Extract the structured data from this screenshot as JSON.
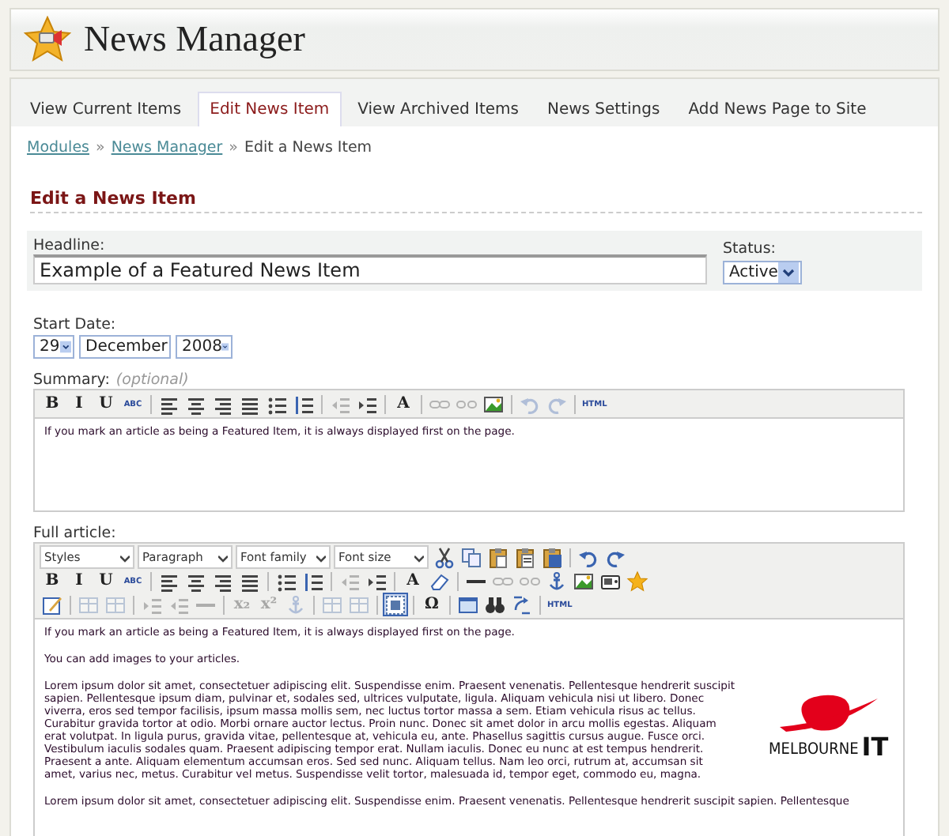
{
  "header": {
    "title": "News Manager"
  },
  "tabs": [
    {
      "label": "View Current Items",
      "selected": false
    },
    {
      "label": "Edit News Item",
      "selected": true
    },
    {
      "label": "View Archived Items",
      "selected": false
    },
    {
      "label": "News Settings",
      "selected": false
    },
    {
      "label": "Add News Page to Site",
      "selected": false
    }
  ],
  "breadcrumb": {
    "links": [
      "Modules",
      "News Manager"
    ],
    "separator": "»",
    "current": "Edit a News Item"
  },
  "section_title": "Edit a News Item",
  "headline": {
    "label": "Headline:",
    "value": "Example of a Featured News Item"
  },
  "status": {
    "label": "Status:",
    "value": "Active"
  },
  "start_date": {
    "label": "Start Date:",
    "day": "29",
    "month": "December",
    "year": "2008"
  },
  "summary": {
    "label": "Summary:",
    "note": "(optional)",
    "toolbar": [
      [
        {
          "kind": "glyph",
          "glyph": "B",
          "disabled": false
        },
        {
          "kind": "glyph",
          "glyph": "I",
          "disabled": false
        },
        {
          "kind": "glyph",
          "glyph": "U",
          "disabled": false
        },
        {
          "kind": "glyph",
          "glyph": "ABC",
          "disabled": false
        }
      ],
      [
        {
          "kind": "align-left",
          "disabled": false
        },
        {
          "kind": "align-center",
          "disabled": false
        },
        {
          "kind": "align-right",
          "disabled": false
        },
        {
          "kind": "justify",
          "disabled": false
        },
        {
          "kind": "bullet-list",
          "disabled": false
        },
        {
          "kind": "numbered-list",
          "disabled": false
        }
      ],
      [
        {
          "kind": "outdent",
          "disabled": true
        },
        {
          "kind": "indent",
          "disabled": false
        }
      ],
      [
        {
          "kind": "glyph",
          "glyph": "A",
          "disabled": false
        }
      ],
      [
        {
          "kind": "link",
          "disabled": true
        },
        {
          "kind": "unlink",
          "disabled": true
        },
        {
          "kind": "image",
          "disabled": false
        }
      ],
      [
        {
          "kind": "undo",
          "disabled": true
        },
        {
          "kind": "redo",
          "disabled": true
        }
      ],
      [
        {
          "kind": "glyph",
          "glyph": "HTML",
          "disabled": false
        }
      ]
    ],
    "paragraphs": [
      "If you mark an article as being a Featured Item, it is always displayed first on the page."
    ]
  },
  "full_article": {
    "label": "Full article:",
    "dropdowns": [
      "Styles",
      "Paragraph",
      "Font family",
      "Font size"
    ],
    "toolbar_rows": [
      [
        [
          {
            "kind": "cut",
            "disabled": false
          },
          {
            "kind": "copy",
            "disabled": false
          },
          {
            "kind": "paste",
            "disabled": false
          },
          {
            "kind": "paste-text",
            "disabled": false
          },
          {
            "kind": "paste-word",
            "disabled": false
          }
        ],
        [
          {
            "kind": "undo",
            "disabled": false
          },
          {
            "kind": "redo",
            "disabled": false
          }
        ]
      ],
      [
        [
          {
            "kind": "glyph",
            "glyph": "B",
            "disabled": false
          },
          {
            "kind": "glyph",
            "glyph": "I",
            "disabled": false
          },
          {
            "kind": "glyph",
            "glyph": "U",
            "disabled": false
          },
          {
            "kind": "glyph",
            "glyph": "ABC",
            "disabled": false
          }
        ],
        [
          {
            "kind": "align-left",
            "disabled": false
          },
          {
            "kind": "align-center",
            "disabled": false
          },
          {
            "kind": "align-right",
            "disabled": false
          },
          {
            "kind": "justify",
            "disabled": false
          }
        ],
        [
          {
            "kind": "bullet-list",
            "disabled": false
          },
          {
            "kind": "numbered-list",
            "disabled": false
          }
        ],
        [
          {
            "kind": "outdent",
            "disabled": true
          },
          {
            "kind": "indent",
            "disabled": false
          }
        ],
        [
          {
            "kind": "glyph",
            "glyph": "A",
            "disabled": false
          },
          {
            "kind": "eraser",
            "disabled": false
          }
        ],
        [
          {
            "kind": "rule",
            "disabled": false
          },
          {
            "kind": "link",
            "disabled": true
          },
          {
            "kind": "unlink",
            "disabled": true
          },
          {
            "kind": "anchor",
            "disabled": false
          },
          {
            "kind": "image",
            "disabled": false
          },
          {
            "kind": "media",
            "disabled": false
          },
          {
            "kind": "star",
            "disabled": false
          }
        ]
      ],
      [
        [
          {
            "kind": "edit",
            "disabled": false
          }
        ],
        [
          {
            "kind": "table",
            "disabled": true
          },
          {
            "kind": "table",
            "disabled": true
          }
        ],
        [
          {
            "kind": "indent",
            "disabled": true
          },
          {
            "kind": "outdent",
            "disabled": true
          },
          {
            "kind": "rule",
            "disabled": true
          }
        ],
        [
          {
            "kind": "glyph",
            "glyph": "x₂",
            "disabled": true
          },
          {
            "kind": "glyph",
            "glyph": "x²",
            "disabled": true
          },
          {
            "kind": "anchor",
            "disabled": true
          }
        ],
        [
          {
            "kind": "table",
            "disabled": true
          },
          {
            "kind": "table",
            "disabled": true
          }
        ],
        [
          {
            "kind": "visual-aid",
            "disabled": false,
            "pressed": true
          }
        ],
        [
          {
            "kind": "glyph",
            "glyph": "Ω",
            "disabled": false
          }
        ],
        [
          {
            "kind": "fullscreen",
            "disabled": false
          },
          {
            "kind": "find",
            "disabled": false
          },
          {
            "kind": "replace",
            "disabled": false
          }
        ],
        [
          {
            "kind": "glyph",
            "glyph": "HTML",
            "disabled": false
          }
        ]
      ]
    ],
    "paragraphs": [
      {
        "text": "If you mark an article as being a Featured Item, it is always displayed first on the page."
      },
      {
        "text": "You can add images to your articles."
      },
      {
        "image": {
          "logo_text": "MELBOURNE",
          "logo_mark": "IT"
        },
        "text": "Lorem ipsum dolor sit amet, consectetuer adipiscing elit. Suspendisse enim. Praesent venenatis. Pellentesque hendrerit suscipit sapien. Pellentesque ipsum diam, pulvinar et, sodales sed, ultrices vulputate, ligula. Aliquam vehicula nisi ut libero. Donec viverra, eros sed tempor facilisis, ipsum massa mollis sem, nec luctus tortor massa a sem. Etiam vehicula risus ac tellus. Curabitur gravida tortor at odio. Morbi ornare auctor lectus. Proin nunc. Donec sit amet dolor in arcu mollis egestas. Aliquam erat volutpat. In ligula purus, gravida vitae, pellentesque at, vehicula eu, ante. Phasellus sagittis cursus augue. Fusce orci. Vestibulum iaculis sodales quam. Praesent adipiscing tempor erat. Nullam iaculis. Donec eu nunc at est tempus hendrerit. Praesent a ante. Aliquam elementum accumsan eros. Sed sed nunc. Aliquam tellus. Nam leo orci, rutrum at, accumsan sit amet, varius nec, metus. Curabitur vel metus. Suspendisse velit tortor, malesuada id, tempor eget, commodo eu, magna."
      },
      {
        "text": "Lorem ipsum dolor sit amet, consectetuer adipiscing elit. Suspendisse enim. Praesent venenatis. Pellentesque hendrerit suscipit sapien. Pellentesque"
      }
    ]
  }
}
